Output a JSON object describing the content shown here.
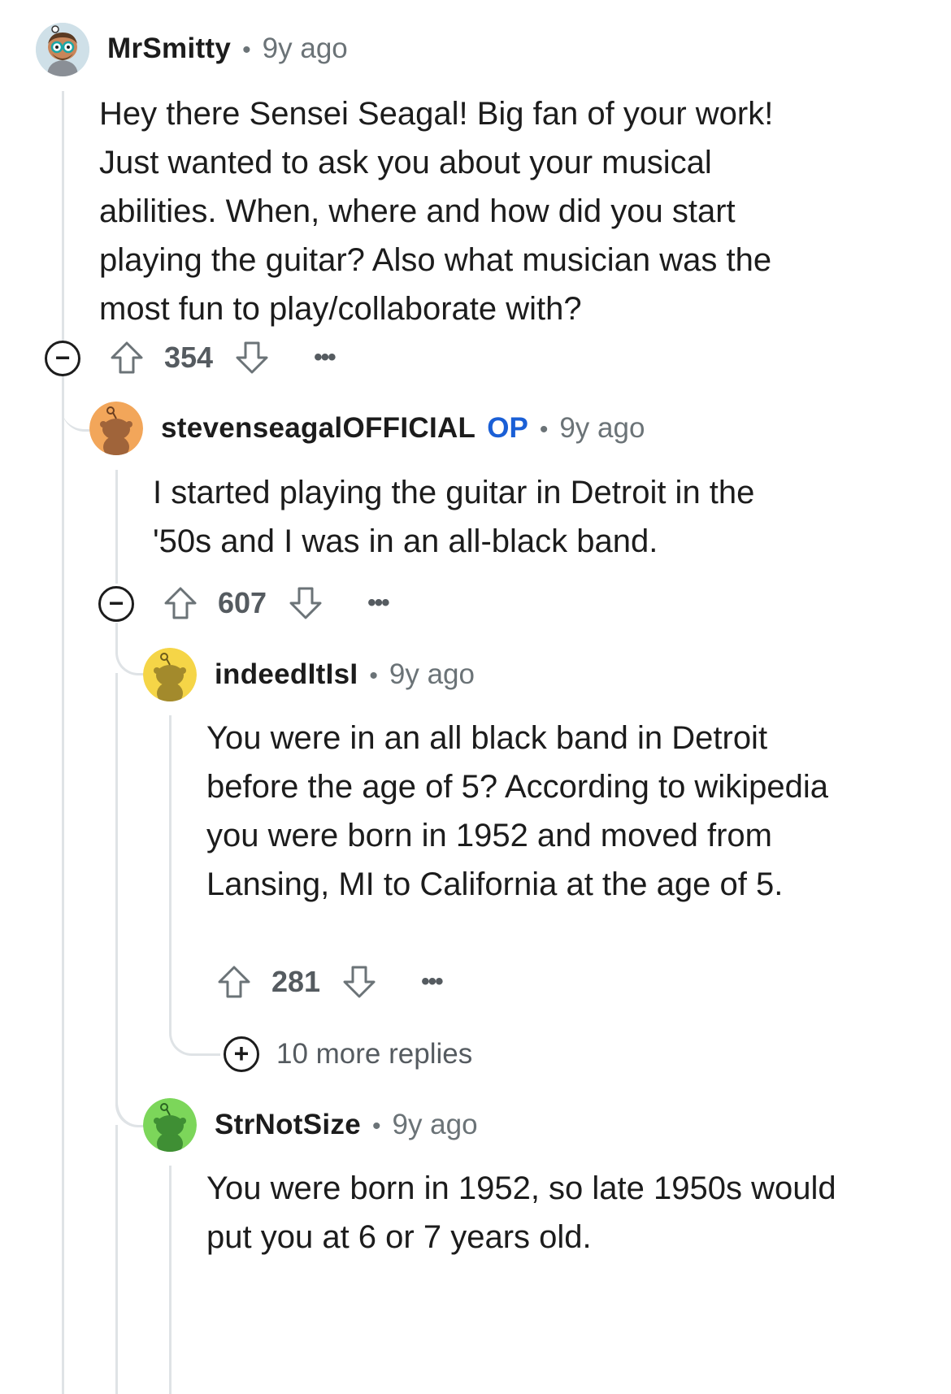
{
  "comments": [
    {
      "username": "MrSmitty",
      "time": "9y ago",
      "body": "Hey there Sensei Seagal! Big fan of your work! Just wanted to ask you about your musical abilities. When, where and how did you start playing the guitar? Also what musician was the most fun to play/collaborate with?",
      "score": "354",
      "avatar_icon": "snoo-avatar-glasses"
    },
    {
      "username": "stevenseagalOFFICIAL",
      "badge": "OP",
      "time": "9y ago",
      "body": "I started playing the guitar in Detroit in the '50s and I was in an all-black band.",
      "score": "607",
      "avatar_color": "#f2a65a",
      "avatar_icon": "snoo-avatar-orange"
    },
    {
      "username": "indeedItIsI",
      "time": "9y ago",
      "body": "You were in an all black band in Detroit before the age of 5? According to wikipedia you were born in 1952 and moved from Lansing, MI to California at the age of 5.",
      "score": "281",
      "avatar_color": "#f5d547",
      "avatar_icon": "snoo-avatar-yellow"
    },
    {
      "username": "StrNotSize",
      "time": "9y ago",
      "body": "You were born in 1952, so late 1950s would put you at 6 or 7 years old.",
      "avatar_color": "#7cd65a",
      "avatar_icon": "snoo-avatar-green"
    }
  ],
  "more_replies": "10 more replies",
  "more_label": "•••",
  "colors": {
    "op_blue": "#1a5fd6",
    "thread_line": "#dfe3e6",
    "meta_gray": "#6b7377"
  }
}
